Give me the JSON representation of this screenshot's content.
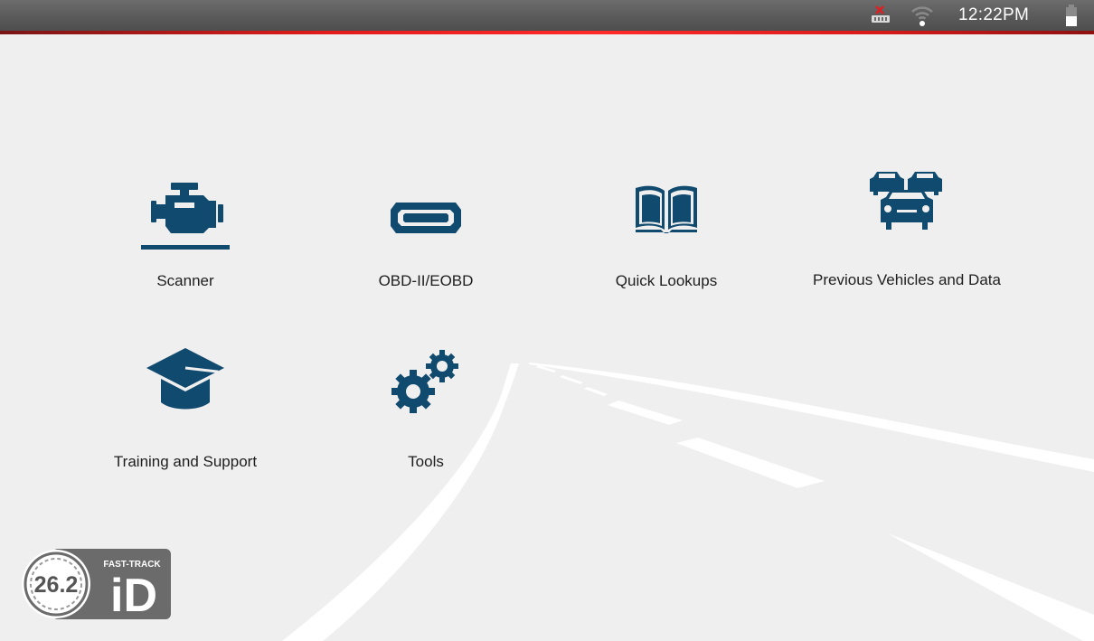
{
  "status_bar": {
    "time": "12:22PM",
    "icons": [
      "vci-disconnected-icon",
      "wifi-icon",
      "battery-icon"
    ]
  },
  "menu": {
    "tiles": [
      {
        "id": "scanner",
        "label": "Scanner",
        "icon": "engine-icon",
        "selected": true
      },
      {
        "id": "obd",
        "label": "OBD-II/EOBD",
        "icon": "obd-connector-icon",
        "selected": false
      },
      {
        "id": "quick-lookups",
        "label": "Quick Lookups",
        "icon": "open-book-icon",
        "selected": false
      },
      {
        "id": "previous-vehicles",
        "label": "Previous Vehicles and Data",
        "icon": "cars-icon",
        "selected": false
      },
      {
        "id": "training",
        "label": "Training and Support",
        "icon": "graduation-cap-icon",
        "selected": false
      },
      {
        "id": "tools",
        "label": "Tools",
        "icon": "gears-icon",
        "selected": false
      }
    ]
  },
  "branding": {
    "version": "26.2",
    "product": "FAST-TRACK",
    "mark": "iD"
  },
  "colors": {
    "icon_blue": "#114a6f",
    "accent_red": "#e31b1b",
    "background": "#efefef"
  }
}
